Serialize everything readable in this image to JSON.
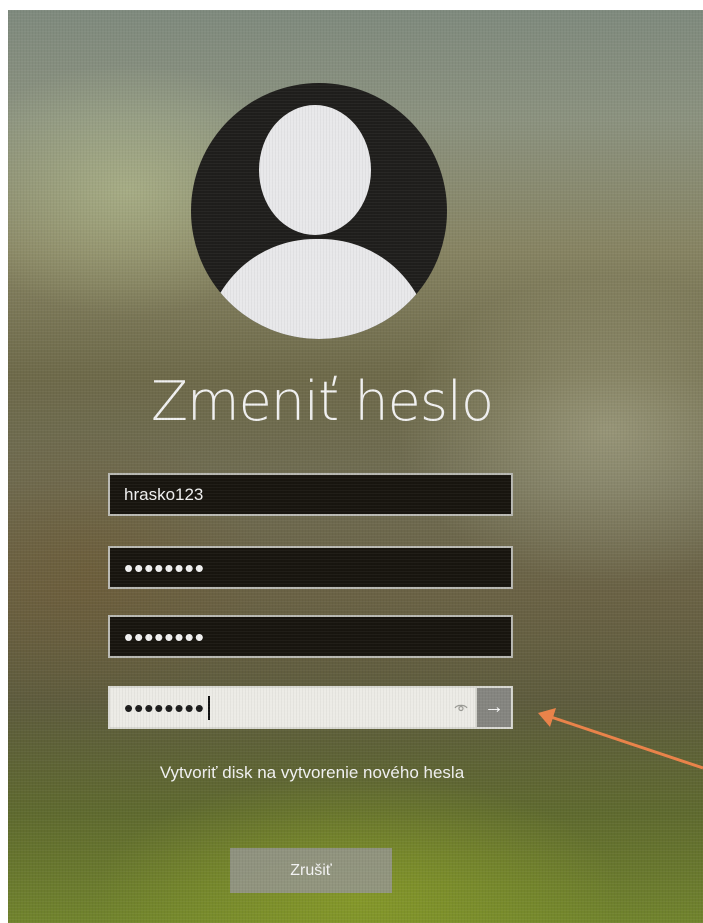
{
  "dialog": {
    "title": "Zmeniť heslo",
    "username_value": "hrasko123",
    "old_password_mask": "••••••••",
    "new_password_mask": "••••••••",
    "confirm_password_mask": "••••••••",
    "reveal_icon": "eye-icon",
    "submit_icon": "arrow-right-icon",
    "submit_glyph": "→",
    "reset_disk_link": "Vytvoriť disk na vytvorenie nového hesla",
    "cancel_label": "Zrušiť"
  },
  "annotation": {
    "arrow_color": "#e9834a"
  },
  "colors": {
    "field_dark": "#18150f",
    "field_active": "#ecebe6",
    "text_light": "#f2f2f2"
  }
}
